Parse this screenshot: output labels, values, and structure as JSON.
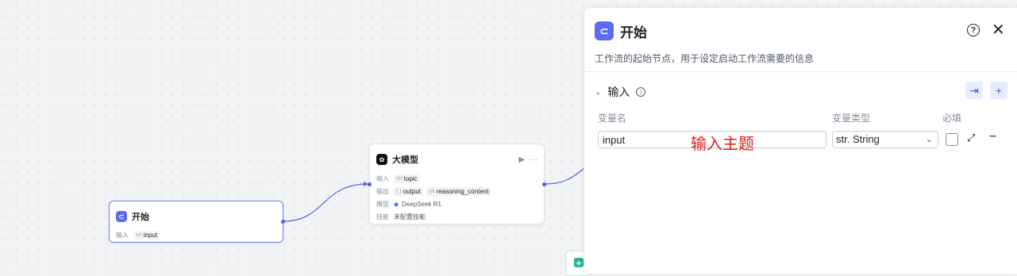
{
  "nodes": {
    "start": {
      "title": "开始",
      "input_label": "输入",
      "input_var": {
        "type": "str",
        "name": "input"
      }
    },
    "llm": {
      "title": "大模型",
      "input_label": "输入",
      "input_var": {
        "type": "str",
        "name": "topic"
      },
      "output_label": "输出",
      "outputs": [
        {
          "type": "{ }",
          "name": "output"
        },
        {
          "type": "str",
          "name": "reasoning_content"
        }
      ],
      "model_label": "模型",
      "model_value": "DeepSeek R1",
      "skill_label": "技能",
      "skill_value": "未配置技能"
    }
  },
  "panel": {
    "title": "开始",
    "description": "工作流的起始节点，用于设定启动工作流需要的信息",
    "section_title": "输入",
    "col_name": "变量名",
    "col_type": "变量类型",
    "col_required": "必填",
    "variable": {
      "name": "input",
      "type": "str. String",
      "required": false
    },
    "annotation": "输入主题"
  },
  "colors": {
    "accent": "#4d5ae6",
    "start_icon": "#5b6cf0",
    "annotation": "#e02020"
  }
}
